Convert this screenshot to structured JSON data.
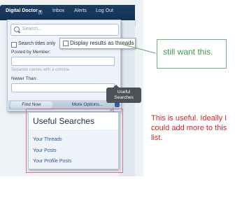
{
  "topbar": {
    "user": "Digital Doctor",
    "inbox": "Inbox",
    "alerts": "Alerts",
    "logout": "Log Out"
  },
  "search": {
    "placeholder": "Search...",
    "titles_only": "Search titles only",
    "display_threads": "Display results as threads",
    "posted_by_label": "Posted by Member:",
    "separate_hint": "Separate names with a comma.",
    "newer_than_label": "Newer Than:",
    "find_now": "Find Now",
    "more_options": "More Options..."
  },
  "tooltip": {
    "line1": "Useful",
    "line2": "Searches"
  },
  "annotations": {
    "green_note": "still want this.",
    "red_note": "This is useful. Ideally I could add more to this list."
  },
  "useful_searches": {
    "title": "Useful Searches",
    "items": [
      "Your Threads",
      "Your Posts",
      "Your Profile Posts"
    ]
  },
  "colors": {
    "nav_bar": "#1b3e64",
    "green_annotation": "#3d9a4f",
    "red_annotation": "#cc2a2a",
    "link": "#2c5a90"
  }
}
